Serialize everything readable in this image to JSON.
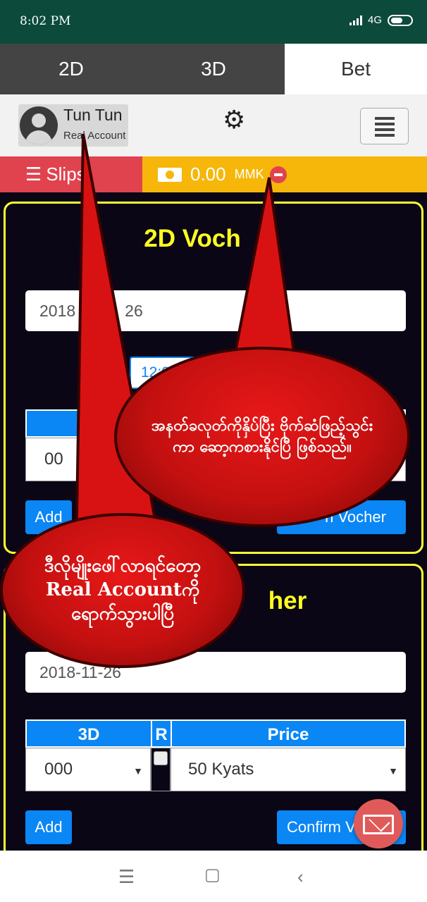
{
  "status_bar": {
    "time": "8:02 PM",
    "network": "4G"
  },
  "tabs": [
    {
      "label": "2D"
    },
    {
      "label": "3D"
    },
    {
      "label": "Bet"
    }
  ],
  "user": {
    "name": "Tun Tun",
    "account_type": "Real Account"
  },
  "slips": {
    "label": "Slips"
  },
  "balance": {
    "amount": "0.00",
    "currency": "MMK"
  },
  "panel_2d": {
    "title": "2D Voch",
    "date": "2018",
    "date_tail": "26",
    "time": "12:0",
    "row_value": "00",
    "add_label": "Add",
    "confirm_label": "n Vocher"
  },
  "panel_3d": {
    "title": "her",
    "date": "2018-11-26",
    "headers": {
      "number": "3D",
      "r": "R",
      "price": "Price"
    },
    "number_value": "000",
    "price_value": "50 Kyats",
    "add_label": "Add",
    "confirm_label": "Confirm V"
  },
  "callouts": {
    "balance_note": "အနတ်ခလုတ်ကိုနှိပ်ပြီး ဗိုက်ဆံဖြည့်သွင်းကာ ဆော့ကစားနိုင်ပြီ ဖြစ်သည်။",
    "account_note_1": "ဒီလိုမျိုးဖေါ်လာရင်တော့",
    "account_note_2": "Real Accountကိုရောက်သွားပါပြီ"
  },
  "colors": {
    "accent_blue": "#0a86f5",
    "panel_border": "#ffff33",
    "slips_red": "#e0434e",
    "balance_yellow": "#f6b70a"
  }
}
